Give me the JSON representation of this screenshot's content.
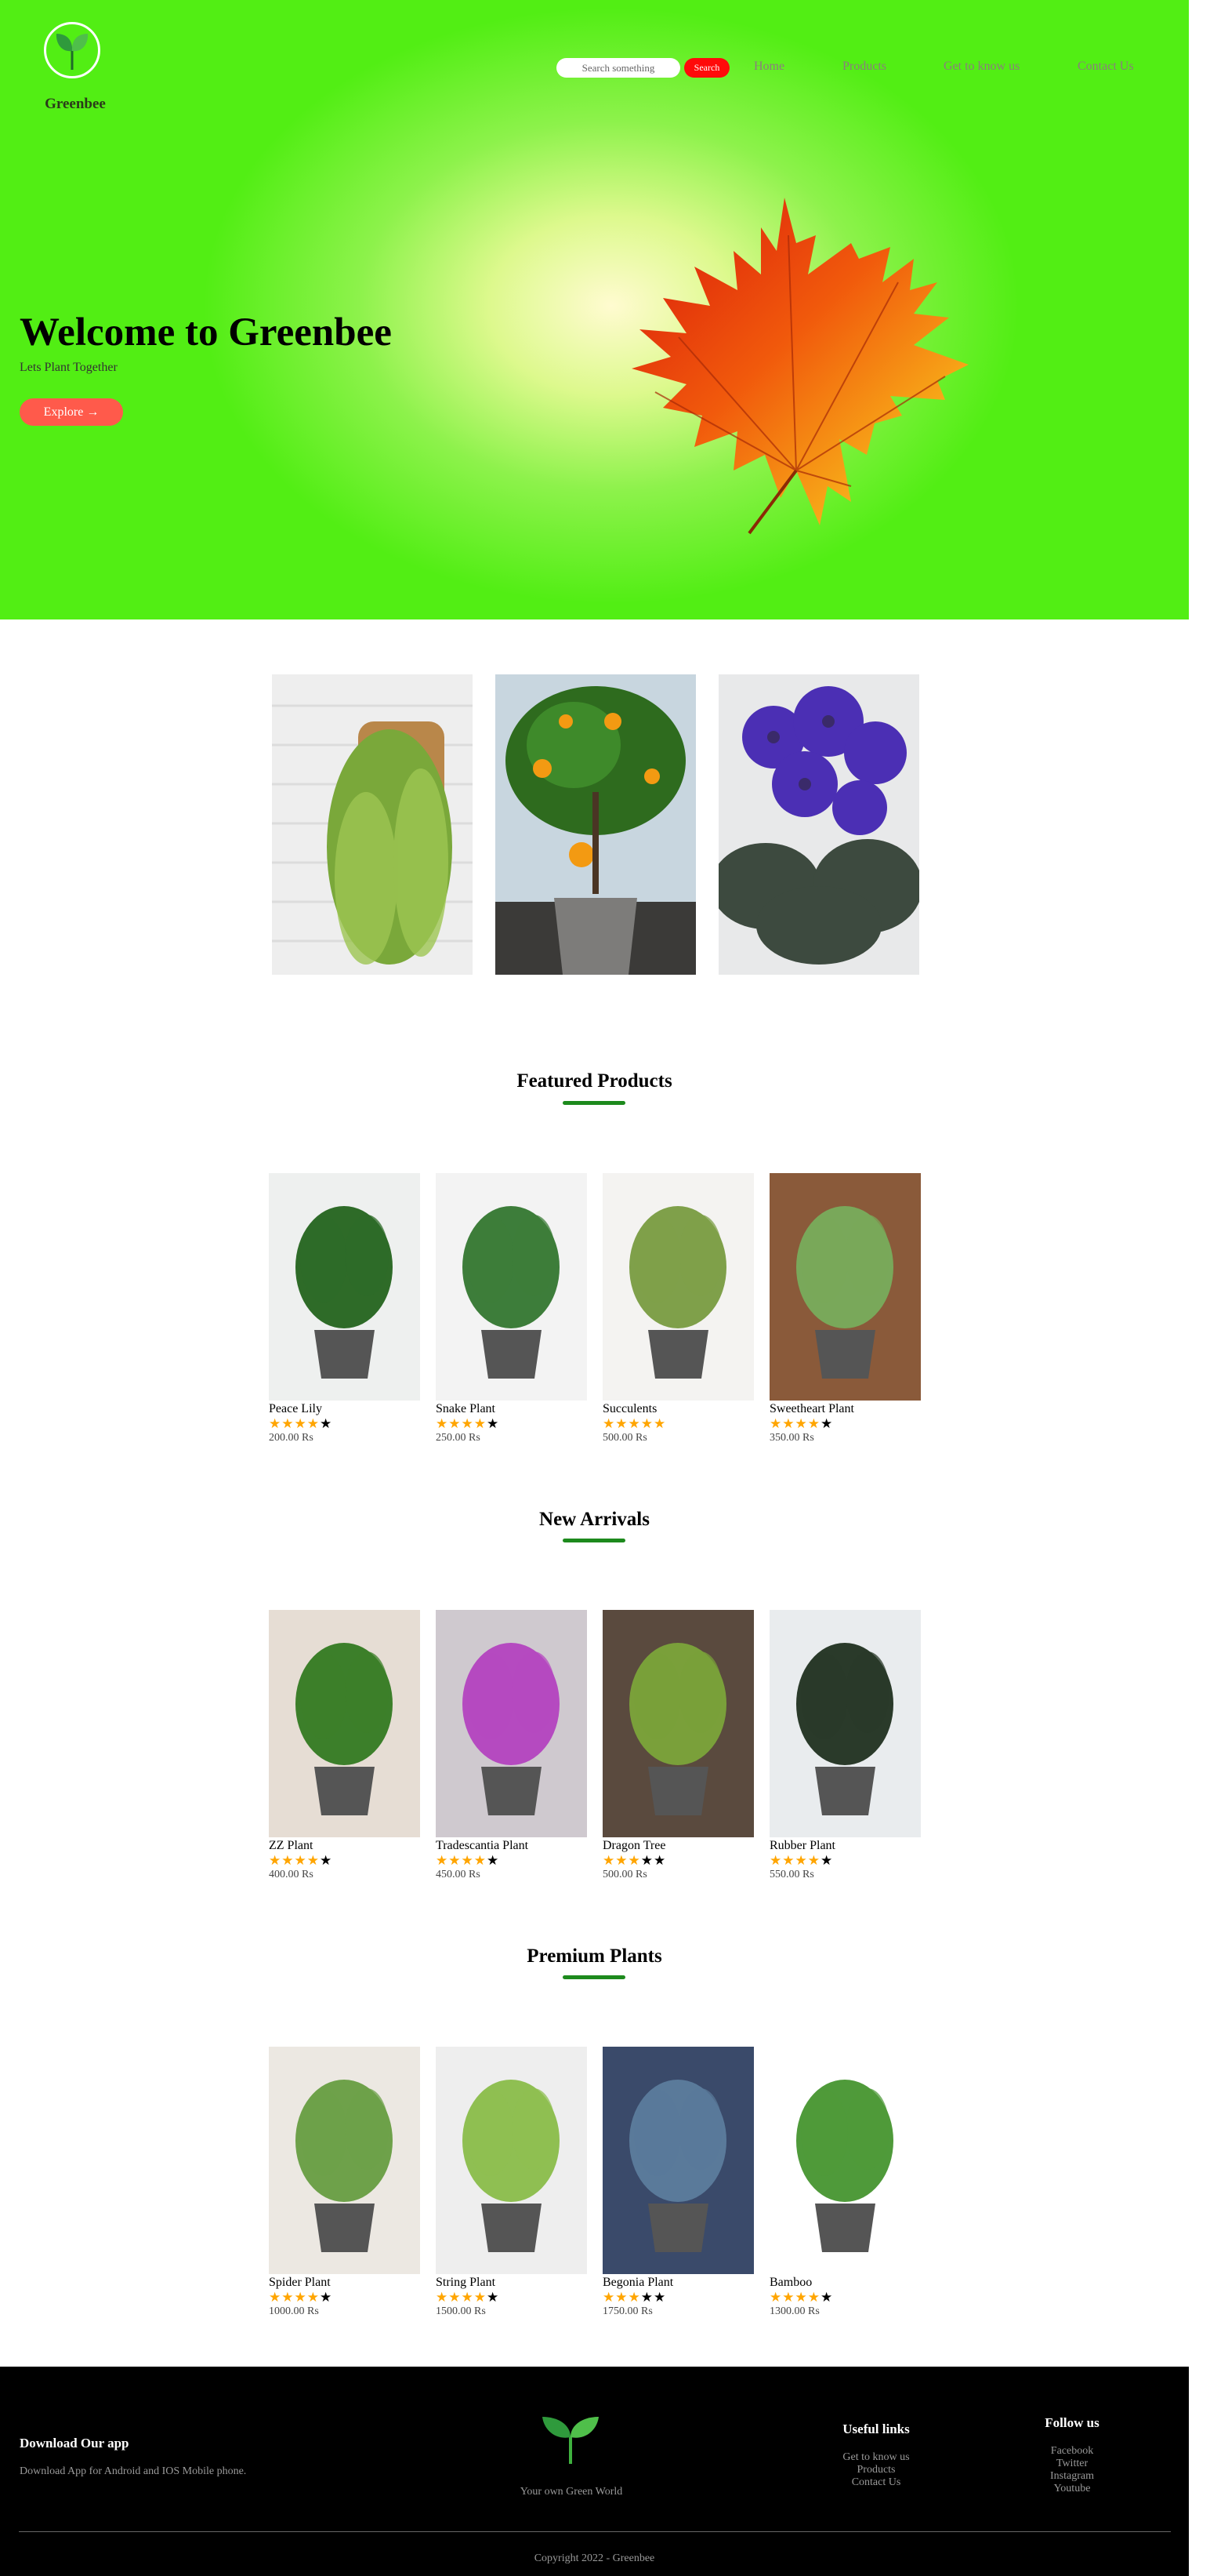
{
  "header": {
    "brand": "Greenbee",
    "search_placeholder": "Search something",
    "search_button": "Search",
    "nav": [
      "Home",
      "Products",
      "Get to know us",
      "Contact Us"
    ]
  },
  "hero": {
    "title": "Welcome to Greenbee",
    "subtitle": "Lets Plant Together",
    "cta": "Explore →"
  },
  "sections": [
    {
      "title": "Featured Products",
      "products": [
        {
          "name": "Peace Lily",
          "rating": 4,
          "price": "200.00 Rs"
        },
        {
          "name": "Snake Plant",
          "rating": 4,
          "price": "250.00 Rs"
        },
        {
          "name": "Succulents",
          "rating": 5,
          "price": "500.00 Rs"
        },
        {
          "name": "Sweetheart Plant",
          "rating": 4,
          "price": "350.00 Rs"
        }
      ]
    },
    {
      "title": "New Arrivals",
      "products": [
        {
          "name": "ZZ Plant",
          "rating": 4,
          "price": "400.00 Rs"
        },
        {
          "name": "Tradescantia Plant",
          "rating": 4,
          "price": "450.00 Rs"
        },
        {
          "name": "Dragon Tree",
          "rating": 3,
          "price": "500.00 Rs"
        },
        {
          "name": "Rubber Plant",
          "rating": 4,
          "price": "550.00 Rs"
        }
      ]
    },
    {
      "title": "Premium Plants",
      "products": [
        {
          "name": "Spider Plant",
          "rating": 4,
          "price": "1000.00 Rs"
        },
        {
          "name": "String Plant",
          "rating": 4,
          "price": "1500.00 Rs"
        },
        {
          "name": "Begonia Plant",
          "rating": 3,
          "price": "1750.00 Rs"
        },
        {
          "name": "Bamboo",
          "rating": 4,
          "price": "1300.00 Rs"
        }
      ]
    }
  ],
  "footer": {
    "download_title": "Download Our app",
    "download_text": "Download App for Android and IOS Mobile phone.",
    "tagline": "Your own Green World",
    "useful_title": "Useful links",
    "useful_links": [
      "Get to know us",
      "Products",
      "Contact Us"
    ],
    "follow_title": "Follow us",
    "follow_links": [
      "Facebook",
      "Twitter",
      "Instagram",
      "Youtube"
    ],
    "copyright": "Copyright 2022 - Greenbee"
  },
  "colors": {
    "hero_green": "#52ee14",
    "accent_red": "#ff0a0a",
    "explore_button": "#ff5a4b",
    "underline_green": "#1d8a1d",
    "star": "#ffa500",
    "footer_bg": "#000000"
  }
}
